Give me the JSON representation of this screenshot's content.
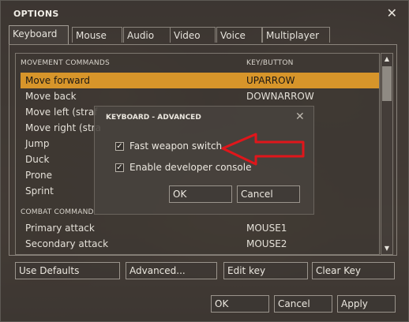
{
  "window": {
    "title": "OPTIONS"
  },
  "tabs": [
    {
      "label": "Keyboard"
    },
    {
      "label": "Mouse"
    },
    {
      "label": "Audio"
    },
    {
      "label": "Video"
    },
    {
      "label": "Voice"
    },
    {
      "label": "Multiplayer"
    }
  ],
  "list": {
    "header_action": "MOVEMENT COMMANDS",
    "header_key": "KEY/BUTTON",
    "movement": [
      {
        "action": "Move forward",
        "key": "UPARROW",
        "selected": true
      },
      {
        "action": "Move back",
        "key": "DOWNARROW"
      },
      {
        "action": "Move left (straf",
        "key": ""
      },
      {
        "action": "Move right (stra",
        "key": ""
      },
      {
        "action": "Jump",
        "key": ""
      },
      {
        "action": "Duck",
        "key": ""
      },
      {
        "action": "Prone",
        "key": ""
      },
      {
        "action": "Sprint",
        "key": ""
      }
    ],
    "combat_header": "COMBAT COMMAND",
    "combat": [
      {
        "action": "Primary attack",
        "key": "MOUSE1"
      },
      {
        "action": "Secondary attack",
        "key": "MOUSE2"
      }
    ]
  },
  "buttons": {
    "use_defaults": "Use Defaults",
    "advanced": "Advanced...",
    "edit_key": "Edit key",
    "clear_key": "Clear Key",
    "ok": "OK",
    "cancel": "Cancel",
    "apply": "Apply"
  },
  "dialog": {
    "title": "KEYBOARD - ADVANCED",
    "options": [
      {
        "label": "Fast weapon switch",
        "checked": true
      },
      {
        "label": "Enable developer console",
        "checked": true
      }
    ],
    "ok": "OK",
    "cancel": "Cancel"
  },
  "colors": {
    "selection": "#d7952a",
    "annotation_arrow": "#e0161b"
  },
  "icons": {
    "close": "close-icon",
    "scroll_up": "arrow-up-icon",
    "scroll_down": "arrow-down-icon",
    "checkbox": "checkmark-icon"
  }
}
